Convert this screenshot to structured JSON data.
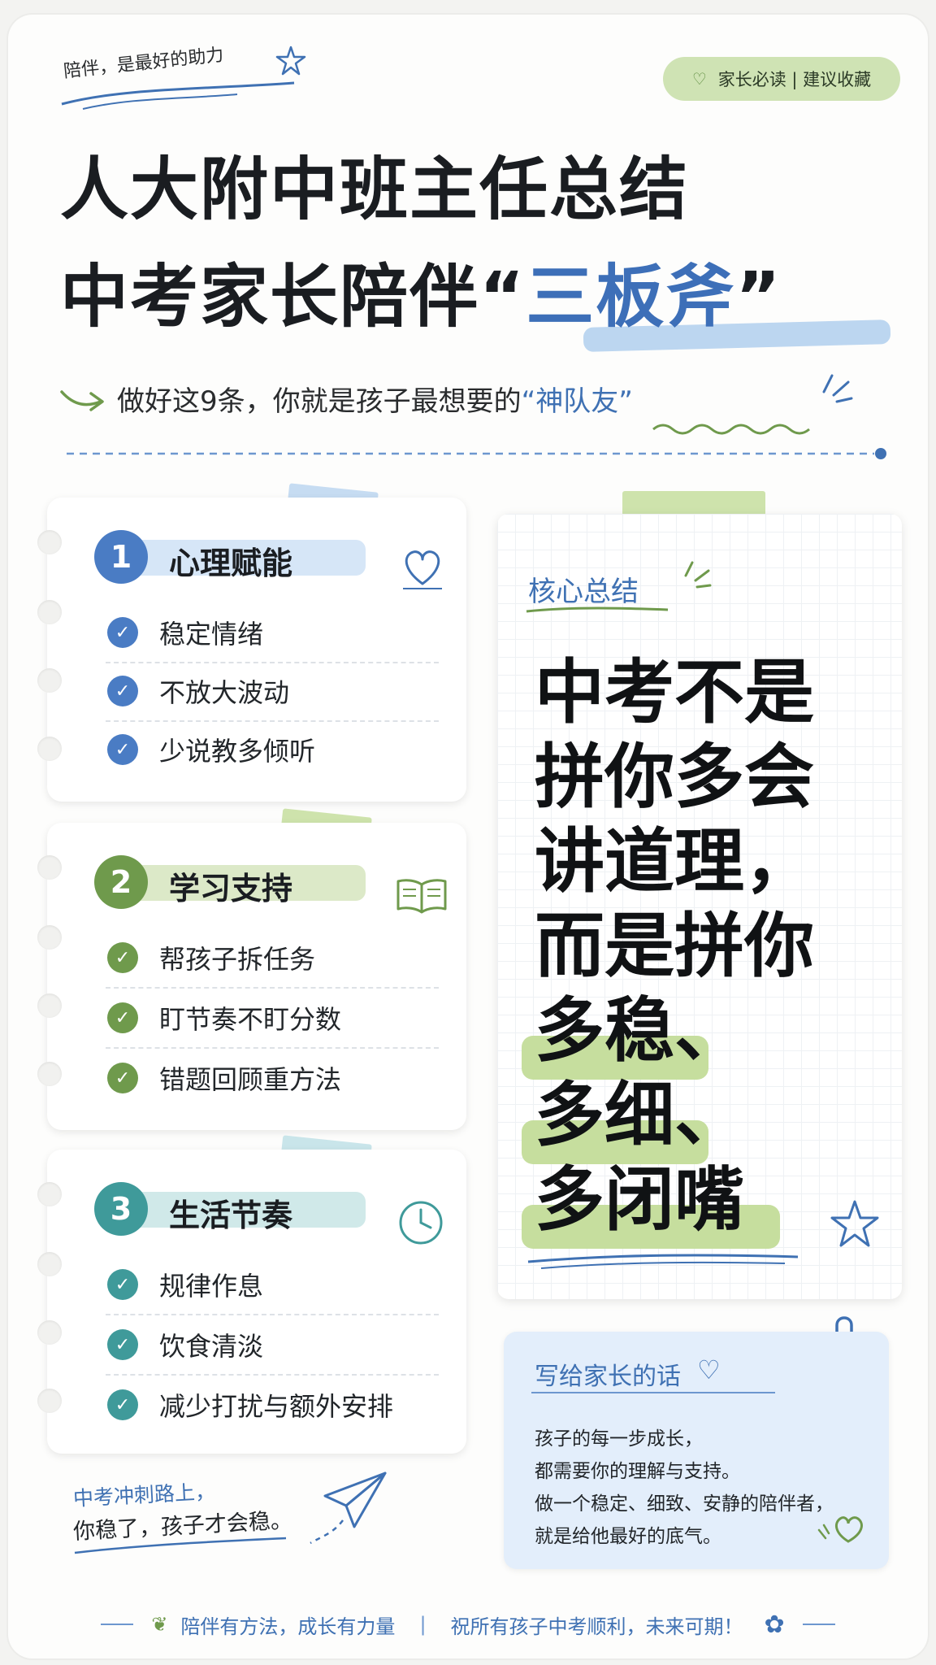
{
  "header": {
    "tagline": "陪伴，是最好的助力",
    "badge": "家长必读 | 建议收藏",
    "title_line1": "人大附中班主任总结",
    "title_line2_prefix": "中考家长陪伴",
    "title_line2_open": "“",
    "title_line2_emphasis": "三板斧",
    "title_line2_close": "”",
    "subtitle_prefix": "做好这9条，你就是孩子最想要的",
    "subtitle_emphasis": "“神队友”"
  },
  "sections": [
    {
      "number": "1",
      "title": "心理赋能",
      "icon": "heart-icon",
      "color": "#4a7cc4",
      "items": [
        "稳定情绪",
        "不放大波动",
        "少说教多倾听"
      ]
    },
    {
      "number": "2",
      "title": "学习支持",
      "icon": "book-icon",
      "color": "#6f9a4c",
      "items": [
        "帮孩子拆任务",
        "盯节奏不盯分数",
        "错题回顾重方法"
      ]
    },
    {
      "number": "3",
      "title": "生活节奏",
      "icon": "clock-icon",
      "color": "#3f9a9a",
      "items": [
        "规律作息",
        "饮食清淡",
        "减少打扰与额外安排"
      ]
    }
  ],
  "core_summary": {
    "label": "核心总结",
    "lines": [
      "中考不是",
      "拼你多会",
      "讲道理，",
      "而是拼你",
      "多稳、",
      "多细、",
      "多闭嘴"
    ]
  },
  "note": {
    "title": "写给家长的话",
    "lines": [
      "孩子的每一步成长，",
      "都需要你的理解与支持。",
      "做一个稳定、细致、安静的陪伴者，",
      "就是给他最好的底气。"
    ]
  },
  "bottom_note": {
    "line1": "中考冲刺路上，",
    "line2": "你稳了，孩子才会稳。"
  },
  "footer": {
    "left": "陪伴有方法，成长有力量",
    "divider": "|",
    "right": "祝所有孩子中考顺利，未来可期！"
  },
  "colors": {
    "blue": "#3f71b3",
    "green": "#6f9a4c",
    "teal": "#3f9a9a",
    "green_highlight": "#c6de9e",
    "blue_highlight": "#bcd6f0"
  }
}
